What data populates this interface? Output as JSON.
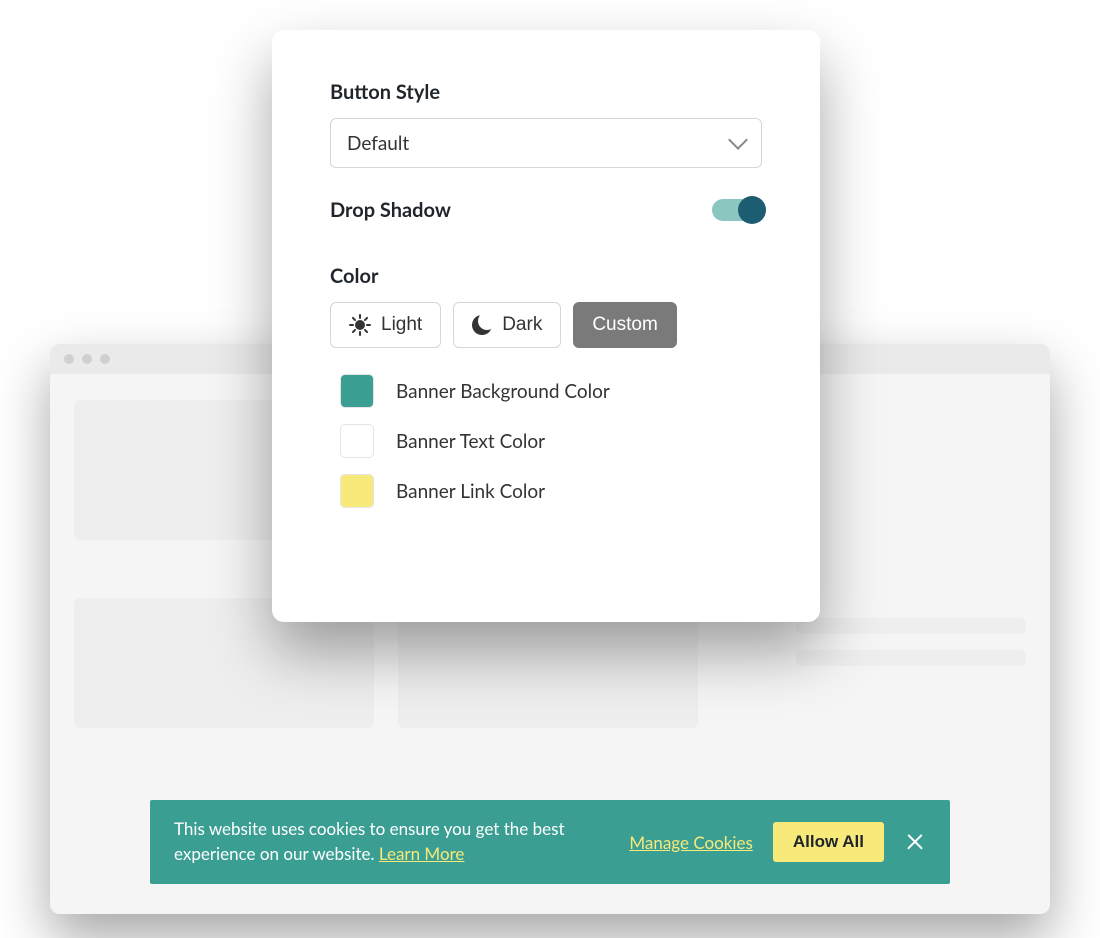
{
  "panel": {
    "button_style": {
      "label": "Button Style",
      "value": "Default"
    },
    "drop_shadow": {
      "label": "Drop Shadow",
      "on": true
    },
    "color": {
      "label": "Color",
      "options": {
        "light": "Light",
        "dark": "Dark",
        "custom": "Custom"
      },
      "selected": "custom",
      "swatches": [
        {
          "label": "Banner Background Color",
          "hex": "#3a9e93"
        },
        {
          "label": "Banner Text Color",
          "hex": "#ffffff"
        },
        {
          "label": "Banner Link Color",
          "hex": "#f7e97a"
        }
      ]
    }
  },
  "cookie": {
    "text_prefix": "This website uses cookies to ensure you get the best experience on our website. ",
    "learn_more": "Learn More",
    "manage": "Manage Cookies",
    "allow": "Allow All"
  }
}
